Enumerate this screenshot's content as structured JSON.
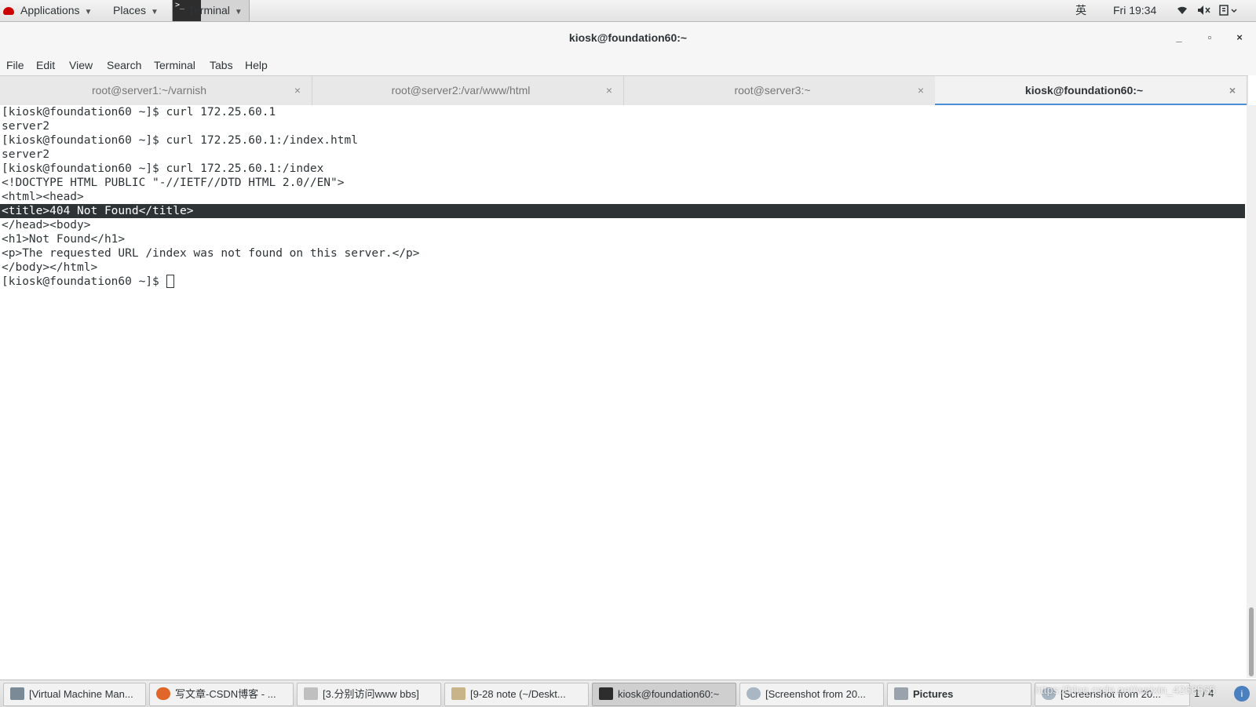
{
  "top_panel": {
    "applications": "Applications",
    "places": "Places",
    "terminal": "Terminal",
    "ime": "英",
    "clock": "Fri 19:34",
    "icons": [
      "wifi-icon",
      "volume-icon",
      "clipboard-icon"
    ]
  },
  "window": {
    "title": "kiosk@foundation60:~",
    "min": "_",
    "max": "▫",
    "close": "×"
  },
  "menubar": [
    "File",
    "Edit",
    "View",
    "Search",
    "Terminal",
    "Tabs",
    "Help"
  ],
  "tabs": [
    {
      "label": "root@server1:~/varnish",
      "close": "×"
    },
    {
      "label": "root@server2:/var/www/html",
      "close": "×"
    },
    {
      "label": "root@server3:~",
      "close": "×"
    },
    {
      "label": "kiosk@foundation60:~",
      "close": "×",
      "active": true
    }
  ],
  "terminal": {
    "lines": [
      "[kiosk@foundation60 ~]$ curl 172.25.60.1",
      "server2",
      "[kiosk@foundation60 ~]$ curl 172.25.60.1:/index.html",
      "server2",
      "[kiosk@foundation60 ~]$ curl 172.25.60.1:/index",
      "<!DOCTYPE HTML PUBLIC \"-//IETF//DTD HTML 2.0//EN\">",
      "<html><head>",
      "<title>404 Not Found</title>",
      "</head><body>",
      "<h1>Not Found</h1>",
      "<p>The requested URL /index was not found on this server.</p>",
      "</body></html>",
      "[kiosk@foundation60 ~]$ "
    ],
    "selected_line_index": 7
  },
  "taskbar": {
    "items": [
      "[Virtual Machine Man...",
      "写文章-CSDN博客 - ...",
      "[3.分别访问www bbs]",
      "[9-28 note (~/Deskt...",
      "kiosk@foundation60:~",
      "[Screenshot from 20...",
      "Pictures",
      "[Screenshot from 20..."
    ],
    "active_index": 4,
    "pager": "1 / 4",
    "watermark": "https://blog.csdn.net/weixin_4268565"
  }
}
